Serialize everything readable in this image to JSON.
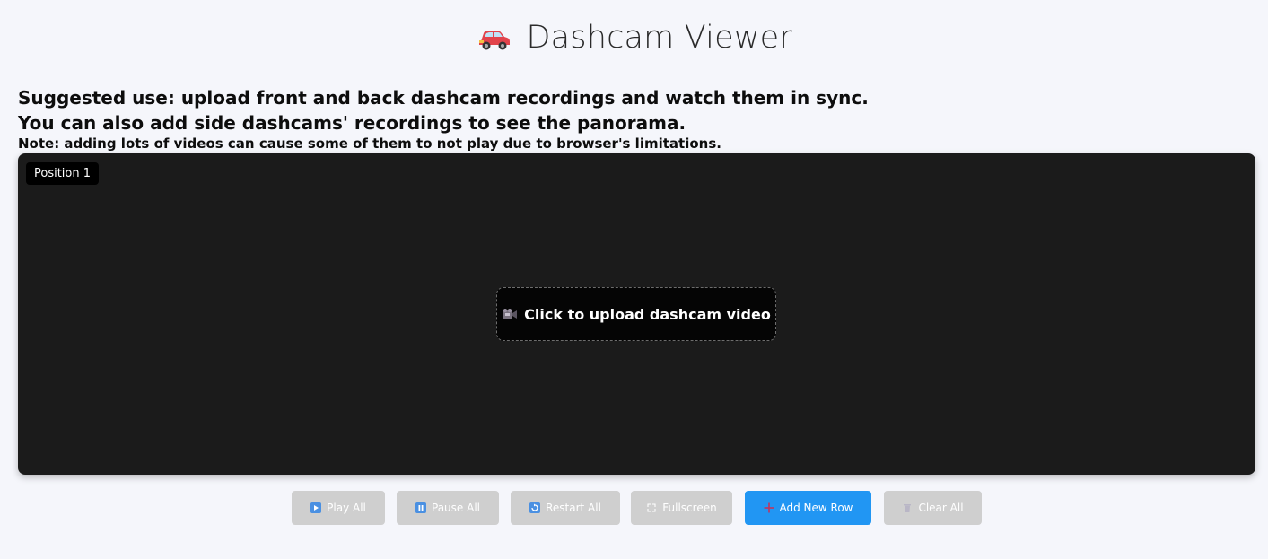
{
  "header": {
    "title": "Dashcam Viewer",
    "icon": "car-icon"
  },
  "intro": {
    "line1": "Suggested use: upload front and back dashcam recordings and watch them in sync.",
    "line2": "You can also add side dashcams' recordings to see the panorama.",
    "note": "Note: adding lots of videos can cause some of them to not play due to browser's limitations."
  },
  "video_slot": {
    "position_label": "Position 1",
    "upload_label": "Click to upload dashcam video",
    "upload_icon": "video-camera-icon"
  },
  "controls": {
    "play_all": "Play All",
    "pause_all": "Pause All",
    "restart_all": "Restart All",
    "fullscreen": "Fullscreen",
    "add_new_row": "Add New Row",
    "clear_all": "Clear All"
  },
  "colors": {
    "page_bg": "#f5f6fb",
    "panel_bg": "#1b1b1b",
    "button_disabled": "#cfcfcf",
    "button_primary": "#2196f3"
  }
}
